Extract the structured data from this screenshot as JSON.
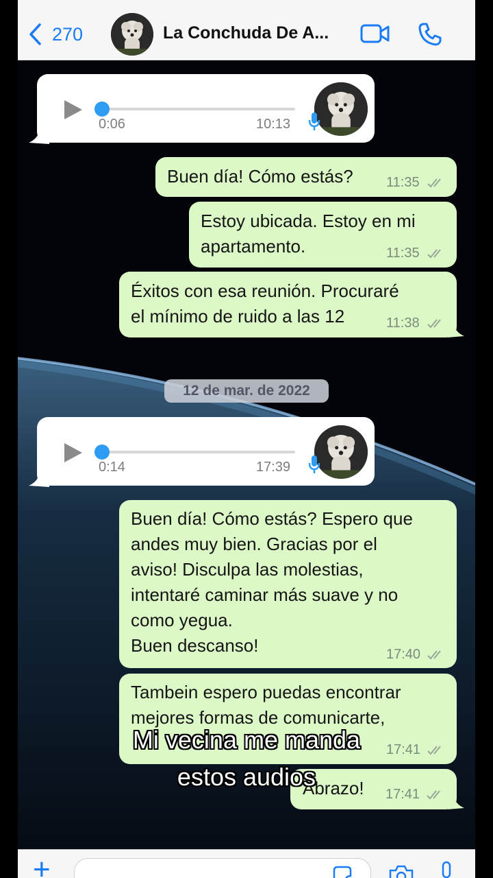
{
  "header": {
    "back_count": "270",
    "title": "La Conchuda De A...",
    "accent_color": "#1a7cf5"
  },
  "messages": {
    "audio1": {
      "duration": "0:06",
      "time": "10:13"
    },
    "m1": {
      "text": "Buen día! Cómo estás?",
      "time": "11:35"
    },
    "m2": {
      "line1": "Estoy ubicada. Estoy en mi",
      "line2": "apartamento.",
      "time": "11:35"
    },
    "m3": {
      "line1": "Éxitos con esa reunión. Procuraré",
      "line2": "el mínimo de ruido a las 12",
      "time": "11:38"
    },
    "date_separator": "12 de mar. de 2022",
    "audio2": {
      "duration": "0:14",
      "time": "17:39"
    },
    "m4": {
      "line1": "Buen día! Cómo estás? Espero que",
      "line2": "andes muy bien. Gracias por el",
      "line3": "aviso! Disculpa las molestias,",
      "line4": "intentaré caminar más suave y no",
      "line5": "como yegua.",
      "line6": "Buen descanso!",
      "time": "17:40"
    },
    "m5": {
      "line1": "Tambein espero puedas encontrar",
      "line2": "mejores formas de comunicarte,",
      "time": "17:41"
    },
    "m6": {
      "text": "Abrazo!",
      "time": "17:41"
    }
  },
  "caption": {
    "line1": "Mi vecina me manda",
    "line2": "estos audios"
  },
  "colors": {
    "incoming": "#ffffff",
    "outgoing": "#dcf8c6",
    "audio_knob": "#2f9cf4"
  }
}
